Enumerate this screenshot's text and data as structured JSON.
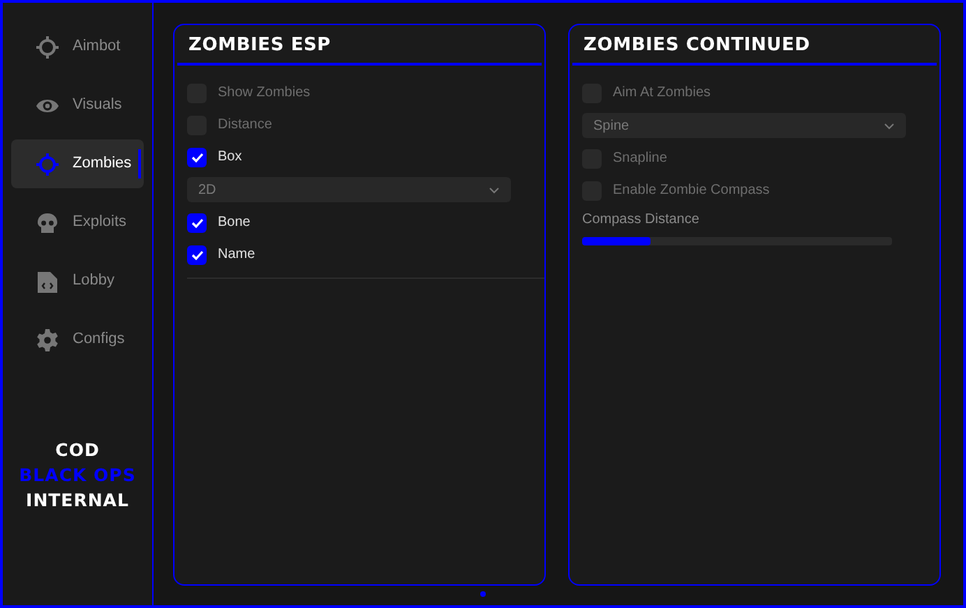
{
  "sidebar": {
    "items": [
      {
        "label": "Aimbot",
        "kind": "crosshair",
        "selected": false
      },
      {
        "label": "Visuals",
        "kind": "eye",
        "selected": false
      },
      {
        "label": "Zombies",
        "kind": "crosshair",
        "selected": true
      },
      {
        "label": "Exploits",
        "kind": "skull",
        "selected": false
      },
      {
        "label": "Lobby",
        "kind": "file",
        "selected": false
      },
      {
        "label": "Configs",
        "kind": "gear",
        "selected": false
      }
    ],
    "logo": [
      {
        "text": "COD",
        "color": "#ffffff"
      },
      {
        "text": "BLACK OPS",
        "color": "#0000ff"
      },
      {
        "text": "INTERNAL",
        "color": "#ffffff"
      }
    ]
  },
  "panels": [
    {
      "title": "ZOMBIES ESP",
      "controls": [
        {
          "kind": "checkbox",
          "label": "Show Zombies",
          "checked": false
        },
        {
          "kind": "checkbox",
          "label": "Distance",
          "checked": false
        },
        {
          "kind": "checkbox",
          "label": "Box",
          "checked": true
        },
        {
          "kind": "dropdown",
          "value": "2D"
        },
        {
          "kind": "checkbox",
          "label": "Bone",
          "checked": true
        },
        {
          "kind": "checkbox",
          "label": "Name",
          "checked": true
        },
        {
          "kind": "separator"
        }
      ]
    },
    {
      "title": "ZOMBIES CONTINUED",
      "controls": [
        {
          "kind": "checkbox",
          "label": "Aim At Zombies",
          "checked": false
        },
        {
          "kind": "dropdown",
          "value": "Spine"
        },
        {
          "kind": "checkbox",
          "label": "Snapline",
          "checked": false
        },
        {
          "kind": "checkbox",
          "label": "Enable Zombie Compass",
          "checked": false
        },
        {
          "kind": "slider",
          "label": "Compass Distance",
          "level": 0.22
        }
      ]
    }
  ]
}
